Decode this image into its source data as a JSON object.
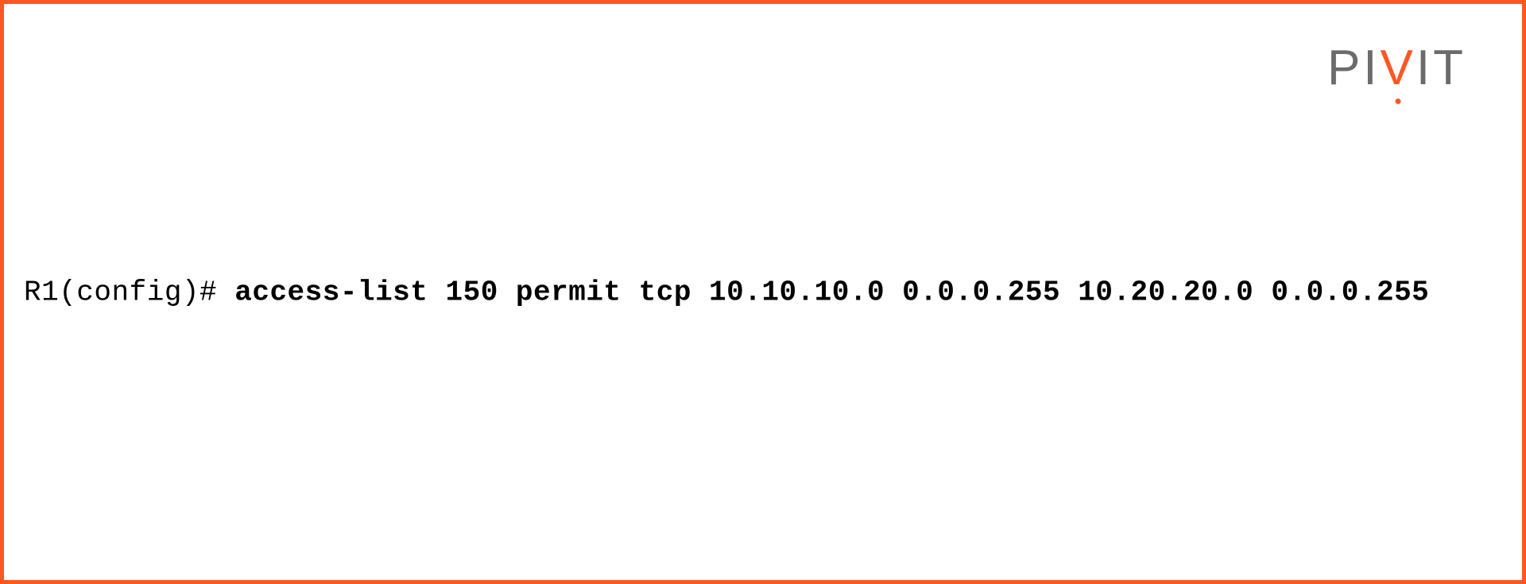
{
  "logo": {
    "part1": "PI",
    "part2": "V",
    "part3": "IT"
  },
  "terminal": {
    "prompt": "R1(config)# ",
    "command": "access-list 150 permit tcp 10.10.10.0 0.0.0.255 10.20.20.0 0.0.0.255"
  }
}
